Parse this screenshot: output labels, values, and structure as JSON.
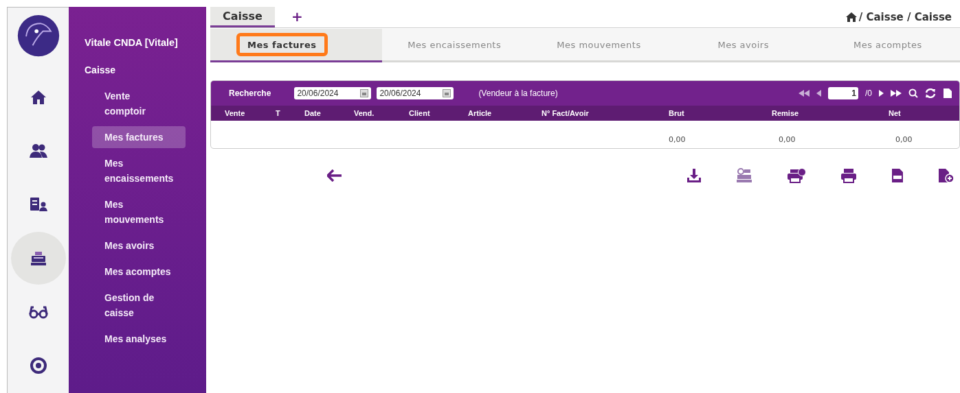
{
  "rail": {
    "items": [
      {
        "kind": "home",
        "selected": false
      },
      {
        "kind": "people",
        "selected": false
      },
      {
        "kind": "badge",
        "selected": false
      },
      {
        "kind": "register",
        "selected": true
      },
      {
        "kind": "glasses",
        "selected": false
      },
      {
        "kind": "eye",
        "selected": false
      }
    ]
  },
  "sidebar": {
    "store": "Vitale CNDA [Vitale]",
    "section": "Caisse",
    "items": [
      {
        "label": "Vente comptoir",
        "selected": false
      },
      {
        "label": "Mes factures",
        "selected": true
      },
      {
        "label": "Mes encaissements",
        "selected": false
      },
      {
        "label": "Mes mouvements",
        "selected": false
      },
      {
        "label": "Mes avoirs",
        "selected": false
      },
      {
        "label": "Mes acomptes",
        "selected": false
      },
      {
        "label": "Gestion de caisse",
        "selected": false
      },
      {
        "label": "Mes analyses",
        "selected": false
      }
    ]
  },
  "top_tabs": [
    {
      "label": "Caisse",
      "selected": true
    },
    {
      "label": "+",
      "selected": false
    }
  ],
  "breadcrumb": [
    "/ Caisse / Caisse"
  ],
  "sub_tabs": [
    {
      "label": "Mes factures",
      "selected": true,
      "highlighted": true
    },
    {
      "label": "Mes encaissements",
      "selected": false,
      "highlighted": false
    },
    {
      "label": "Mes mouvements",
      "selected": false,
      "highlighted": false
    },
    {
      "label": "Mes avoirs",
      "selected": false,
      "highlighted": false
    },
    {
      "label": "Mes acomptes",
      "selected": false,
      "highlighted": false
    }
  ],
  "grid": {
    "search_label": "Recherche",
    "date_from": "20/06/2024",
    "date_to": "20/06/2024",
    "note": "(Vendeur à la facture)",
    "page": "1",
    "page_total": "/0",
    "columns": [
      "Vente",
      "T",
      "Date",
      "Vend.",
      "Client",
      "Article",
      "N° Fact/Avoir",
      "Brut",
      "Remise",
      "Net"
    ],
    "totals": [
      "0,00",
      "0,00",
      "0,00"
    ]
  },
  "actions": [
    {
      "kind": "download"
    },
    {
      "kind": "register"
    },
    {
      "kind": "print-badge"
    },
    {
      "kind": "print"
    },
    {
      "kind": "csv"
    },
    {
      "kind": "file-plus"
    }
  ]
}
